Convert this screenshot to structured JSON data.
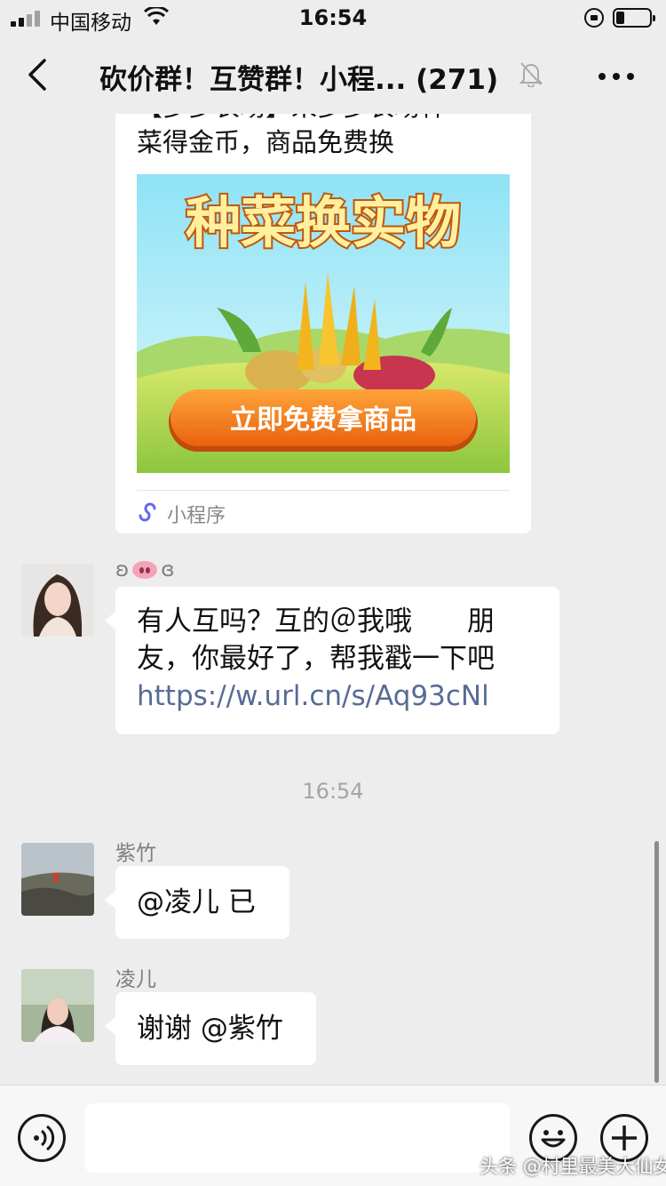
{
  "status_bar": {
    "carrier": "中国移动",
    "time": "16:54",
    "battery_level": 0.25
  },
  "header": {
    "title": "砍价群！互赞群！小程... (271)",
    "back_icon": "chevron-left-icon",
    "mute_icon": "bell-off-icon",
    "more_icon": "more-dots-icon"
  },
  "messages": {
    "mini_program": {
      "desc_line1": "【多多农场】来多多农场种",
      "desc_line2": "菜得金币，商品免费换",
      "banner_title": "种菜换实物",
      "banner_button": "立即免费拿商品",
      "footer_label": "小程序"
    },
    "msg1": {
      "sender_left": "ʚ",
      "sender_right": "ɞ",
      "line1": "有人互吗？互的＠我哦　　朋",
      "line2": "友，你最好了，帮我戳一下吧",
      "link": "https://w.url.cn/s/Aq93cNl"
    },
    "time_divider": "16:54",
    "msg2": {
      "sender": "紫竹",
      "text": "@凌儿 已"
    },
    "msg3": {
      "sender": "凌儿",
      "text": "谢谢 @紫竹"
    }
  },
  "input_bar": {
    "voice_icon": "voice-icon",
    "emoji_icon": "emoji-icon",
    "plus_icon": "plus-icon",
    "input_value": ""
  },
  "watermark": "头条 @村里最美大仙女",
  "colors": {
    "background": "#ededed",
    "bubble": "#ffffff",
    "link": "#576b95",
    "button_orange": "#f47a1f"
  }
}
